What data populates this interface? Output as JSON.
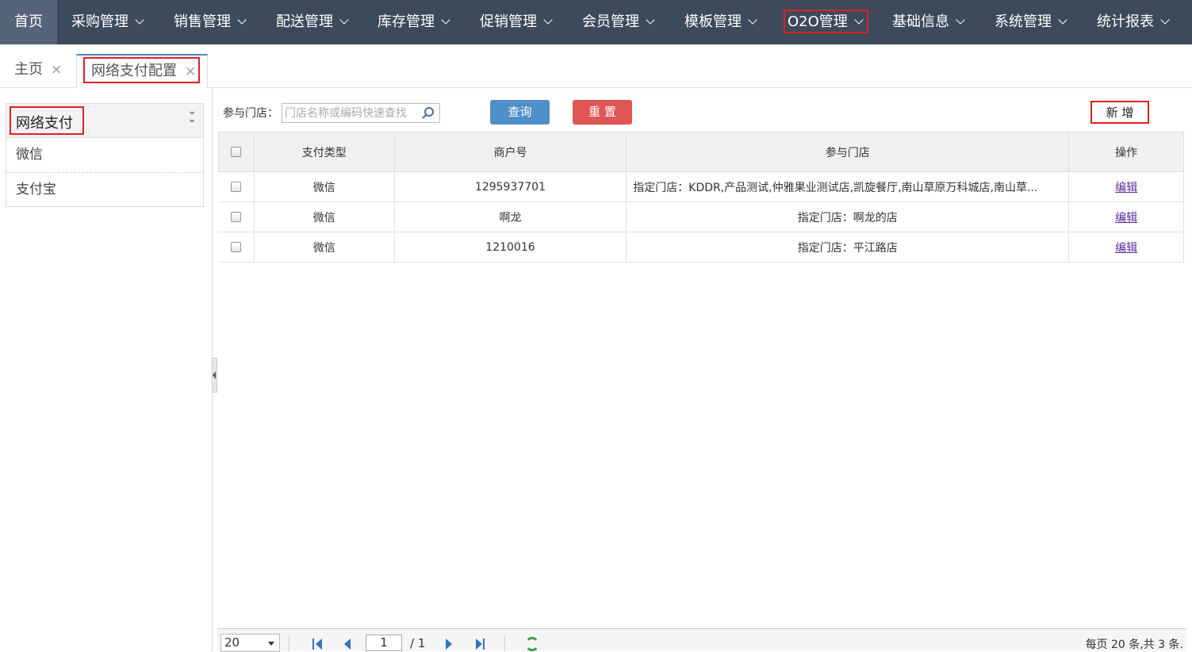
{
  "nav": {
    "home": "首页",
    "items": [
      "采购管理",
      "销售管理",
      "配送管理",
      "库存管理",
      "促销管理",
      "会员管理",
      "模板管理",
      "O2O管理",
      "基础信息",
      "系统管理",
      "统计报表"
    ]
  },
  "tabs": [
    {
      "label": "主页",
      "close": "×"
    },
    {
      "label": "网络支付配置",
      "close": "×"
    }
  ],
  "left": {
    "title": "网络支付",
    "collapse_icon": "double-chevron-down-icon",
    "items": [
      "微信",
      "支付宝"
    ]
  },
  "search": {
    "label": "参与门店：",
    "placeholder": "门店名称或编码快速查找",
    "query_label": "查询",
    "reset_label": "重 置",
    "add_label": "新 增"
  },
  "table": {
    "headers": [
      "支付类型",
      "商户号",
      "参与门店",
      "操作"
    ],
    "rows": [
      {
        "type": "微信",
        "merchant": "1295937701",
        "stores": "指定门店：KDDR,产品测试,仲雅果业测试店,凯旋餐厅,南山草原万科城店,南山草...",
        "action": "编辑"
      },
      {
        "type": "微信",
        "merchant": "啊龙",
        "stores": "指定门店：啊龙的店",
        "action": "编辑"
      },
      {
        "type": "微信",
        "merchant": "1210016",
        "stores": "指定门店：平江路店",
        "action": "编辑"
      }
    ]
  },
  "pager": {
    "page_size": "20",
    "current_page": "1",
    "total_pages": "/ 1",
    "info": "每页 20 条,共 3 条."
  },
  "colors": {
    "nav_bg": "#3d4a5c",
    "query_btn": "#4e8ec9",
    "reset_btn": "#e05555",
    "highlight": "#e02020"
  }
}
